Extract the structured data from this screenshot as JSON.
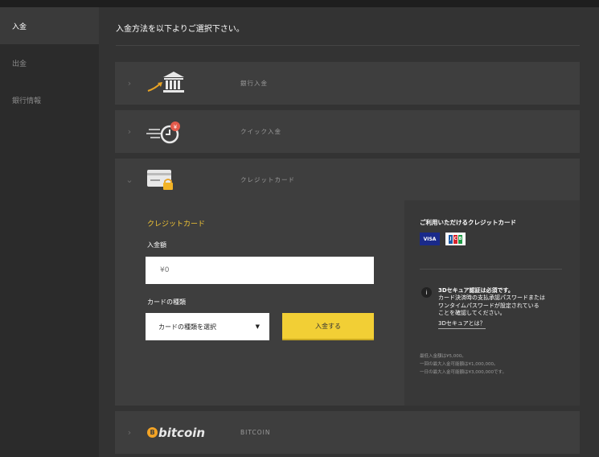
{
  "sidebar": {
    "items": [
      {
        "label": "入金",
        "active": true
      },
      {
        "label": "出金",
        "active": false
      },
      {
        "label": "銀行情報",
        "active": false
      }
    ]
  },
  "main": {
    "title": "入金方法を以下よりご選択下さい。",
    "methods": {
      "bank": {
        "label": "銀行入金",
        "icon": "bank-icon"
      },
      "quick": {
        "label": "クイック入金",
        "icon": "quick-deposit-icon"
      },
      "credit": {
        "label": "クレジットカード",
        "icon": "credit-card-lock-icon"
      },
      "bitcoin": {
        "label": "BITCOIN",
        "logo_text": "bitcoin",
        "logo_mark": "B"
      }
    },
    "chevron_right": "›",
    "chevron_down": "⌄"
  },
  "credit_panel": {
    "title": "クレジットカード",
    "amount_label": "入金額",
    "amount_placeholder": "¥0",
    "card_type_label": "カードの種類",
    "card_select_value": "カードの種類を選択",
    "deposit_button": "入金する",
    "accepted_title": "ご利用いただけるクレジットカード",
    "visa_label": "VISA",
    "jcb_letters": [
      "J",
      "C",
      "B"
    ],
    "info_icon": "i",
    "secure_title": "3Dセキュア認証は必須です。",
    "secure_body_lines": [
      "カード決済時の支払承認パスワードまたは",
      "ワンタイムパスワードが設定されている",
      "ことを確認してください。"
    ],
    "secure_link": "3Dセキュアとは？",
    "limits": [
      "最低入金額は¥5,000。",
      "一回の最大入金可能額は¥1,000,000。",
      "一日の最大入金可能額は¥3,000,000です。"
    ]
  },
  "colors": {
    "accent": "#f2c535",
    "button": "#f2cf35",
    "visa_bg": "#1a2a8a",
    "jcb_j": "#1b5aa6",
    "jcb_c": "#d5242d",
    "jcb_b": "#1f9a46"
  }
}
